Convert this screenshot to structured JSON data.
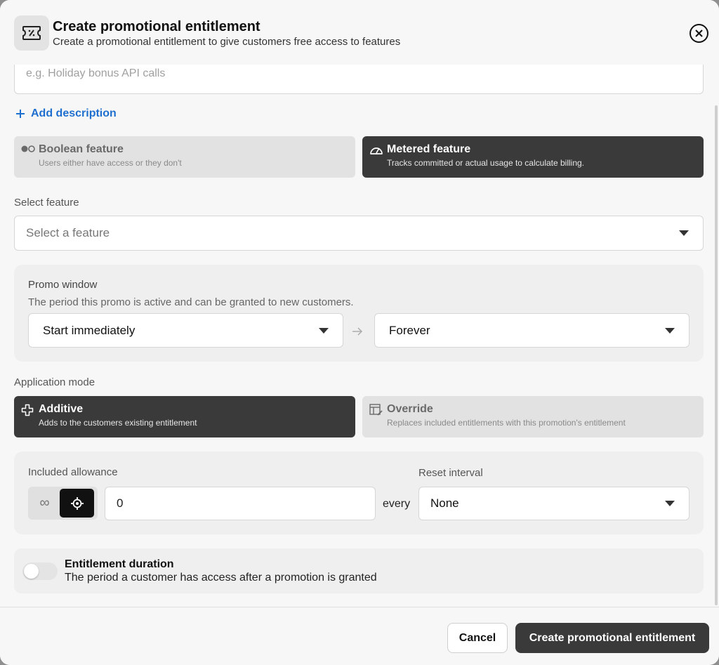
{
  "header": {
    "title": "Create promotional entitlement",
    "subtitle": "Create a promotional entitlement to give customers free access to features",
    "icon": "ticket-percent-icon"
  },
  "name_field": {
    "placeholder": "e.g. Holiday bonus API calls"
  },
  "add_description": "Add description",
  "feature_types": [
    {
      "title": "Boolean feature",
      "description": "Users either have access or they don't",
      "selected": false
    },
    {
      "title": "Metered feature",
      "description": "Tracks committed or actual usage to calculate billing.",
      "selected": true
    }
  ],
  "select_feature": {
    "label": "Select feature",
    "placeholder": "Select a feature"
  },
  "promo_window": {
    "title": "Promo window",
    "description": "The period this promo is active and can be granted to new customers.",
    "start": "Start immediately",
    "end": "Forever"
  },
  "application_mode": {
    "label": "Application mode",
    "options": [
      {
        "title": "Additive",
        "description": "Adds to the customers existing entitlement",
        "selected": true
      },
      {
        "title": "Override",
        "description": "Replaces included entitlements with this promotion's entitlement",
        "selected": false
      }
    ]
  },
  "allowance": {
    "label": "Included allowance",
    "value": "0",
    "every": "every",
    "reset_label": "Reset interval",
    "reset_value": "None"
  },
  "duration": {
    "title": "Entitlement duration",
    "description": "The period a customer has access after a promotion is granted",
    "enabled": false
  },
  "footer": {
    "cancel": "Cancel",
    "create": "Create promotional entitlement"
  },
  "colors": {
    "accent_link": "#1f6fcf",
    "selected_card": "#3a3a3a",
    "unselected_card": "#e2e2e2",
    "panel": "#efefef"
  }
}
